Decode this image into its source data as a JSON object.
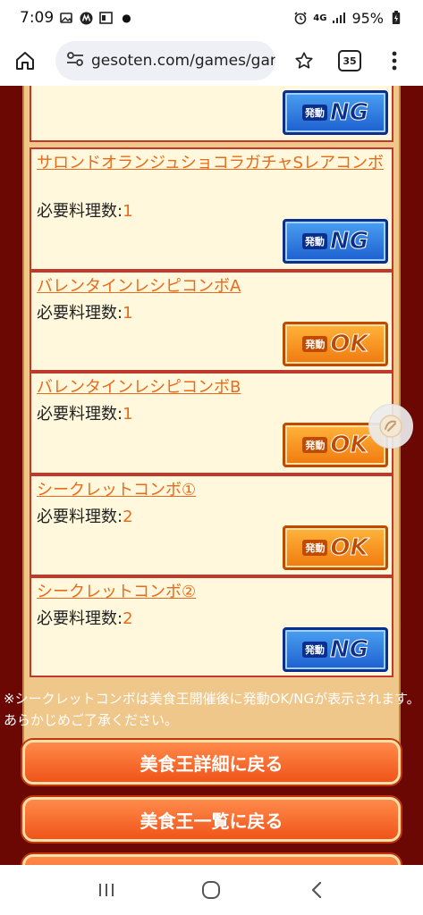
{
  "status_bar": {
    "time": "7:09",
    "network": "4G",
    "battery": "95%"
  },
  "browser": {
    "url": "gesoten.com/games/gar",
    "tab_count": "35"
  },
  "combos": [
    {
      "name": "",
      "requirement_label": "",
      "requirement_value": "",
      "status": "NG"
    },
    {
      "name": "サロンドオランジュショコラガチャSレアコンボ",
      "requirement_label": "必要料理数:",
      "requirement_value": "1",
      "status": "NG"
    },
    {
      "name": "バレンタインレシピコンボA",
      "requirement_label": "必要料理数:",
      "requirement_value": "1",
      "status": "OK"
    },
    {
      "name": "バレンタインレシピコンボB",
      "requirement_label": "必要料理数:",
      "requirement_value": "1",
      "status": "OK"
    },
    {
      "name": "シークレットコンボ①",
      "requirement_label": "必要料理数:",
      "requirement_value": "2",
      "status": "OK"
    },
    {
      "name": "シークレットコンボ②",
      "requirement_label": "必要料理数:",
      "requirement_value": "2",
      "status": "NG"
    }
  ],
  "badge": {
    "prefix": "発動",
    "ok": "OK",
    "ng": "NG"
  },
  "note": "※シークレットコンボは美食王開催後に発動OK/NGが表示されます。あらかじめご了承ください。",
  "nav_buttons": {
    "back_to_detail": "美食王詳細に戻る",
    "back_to_list": "美食王一覧に戻る"
  },
  "colors": {
    "page_background": "#6b0804",
    "link": "#e86a1a",
    "item_border": "#c0392b",
    "ok_badge": "#f07a10",
    "ng_badge": "#1d5fd0"
  }
}
